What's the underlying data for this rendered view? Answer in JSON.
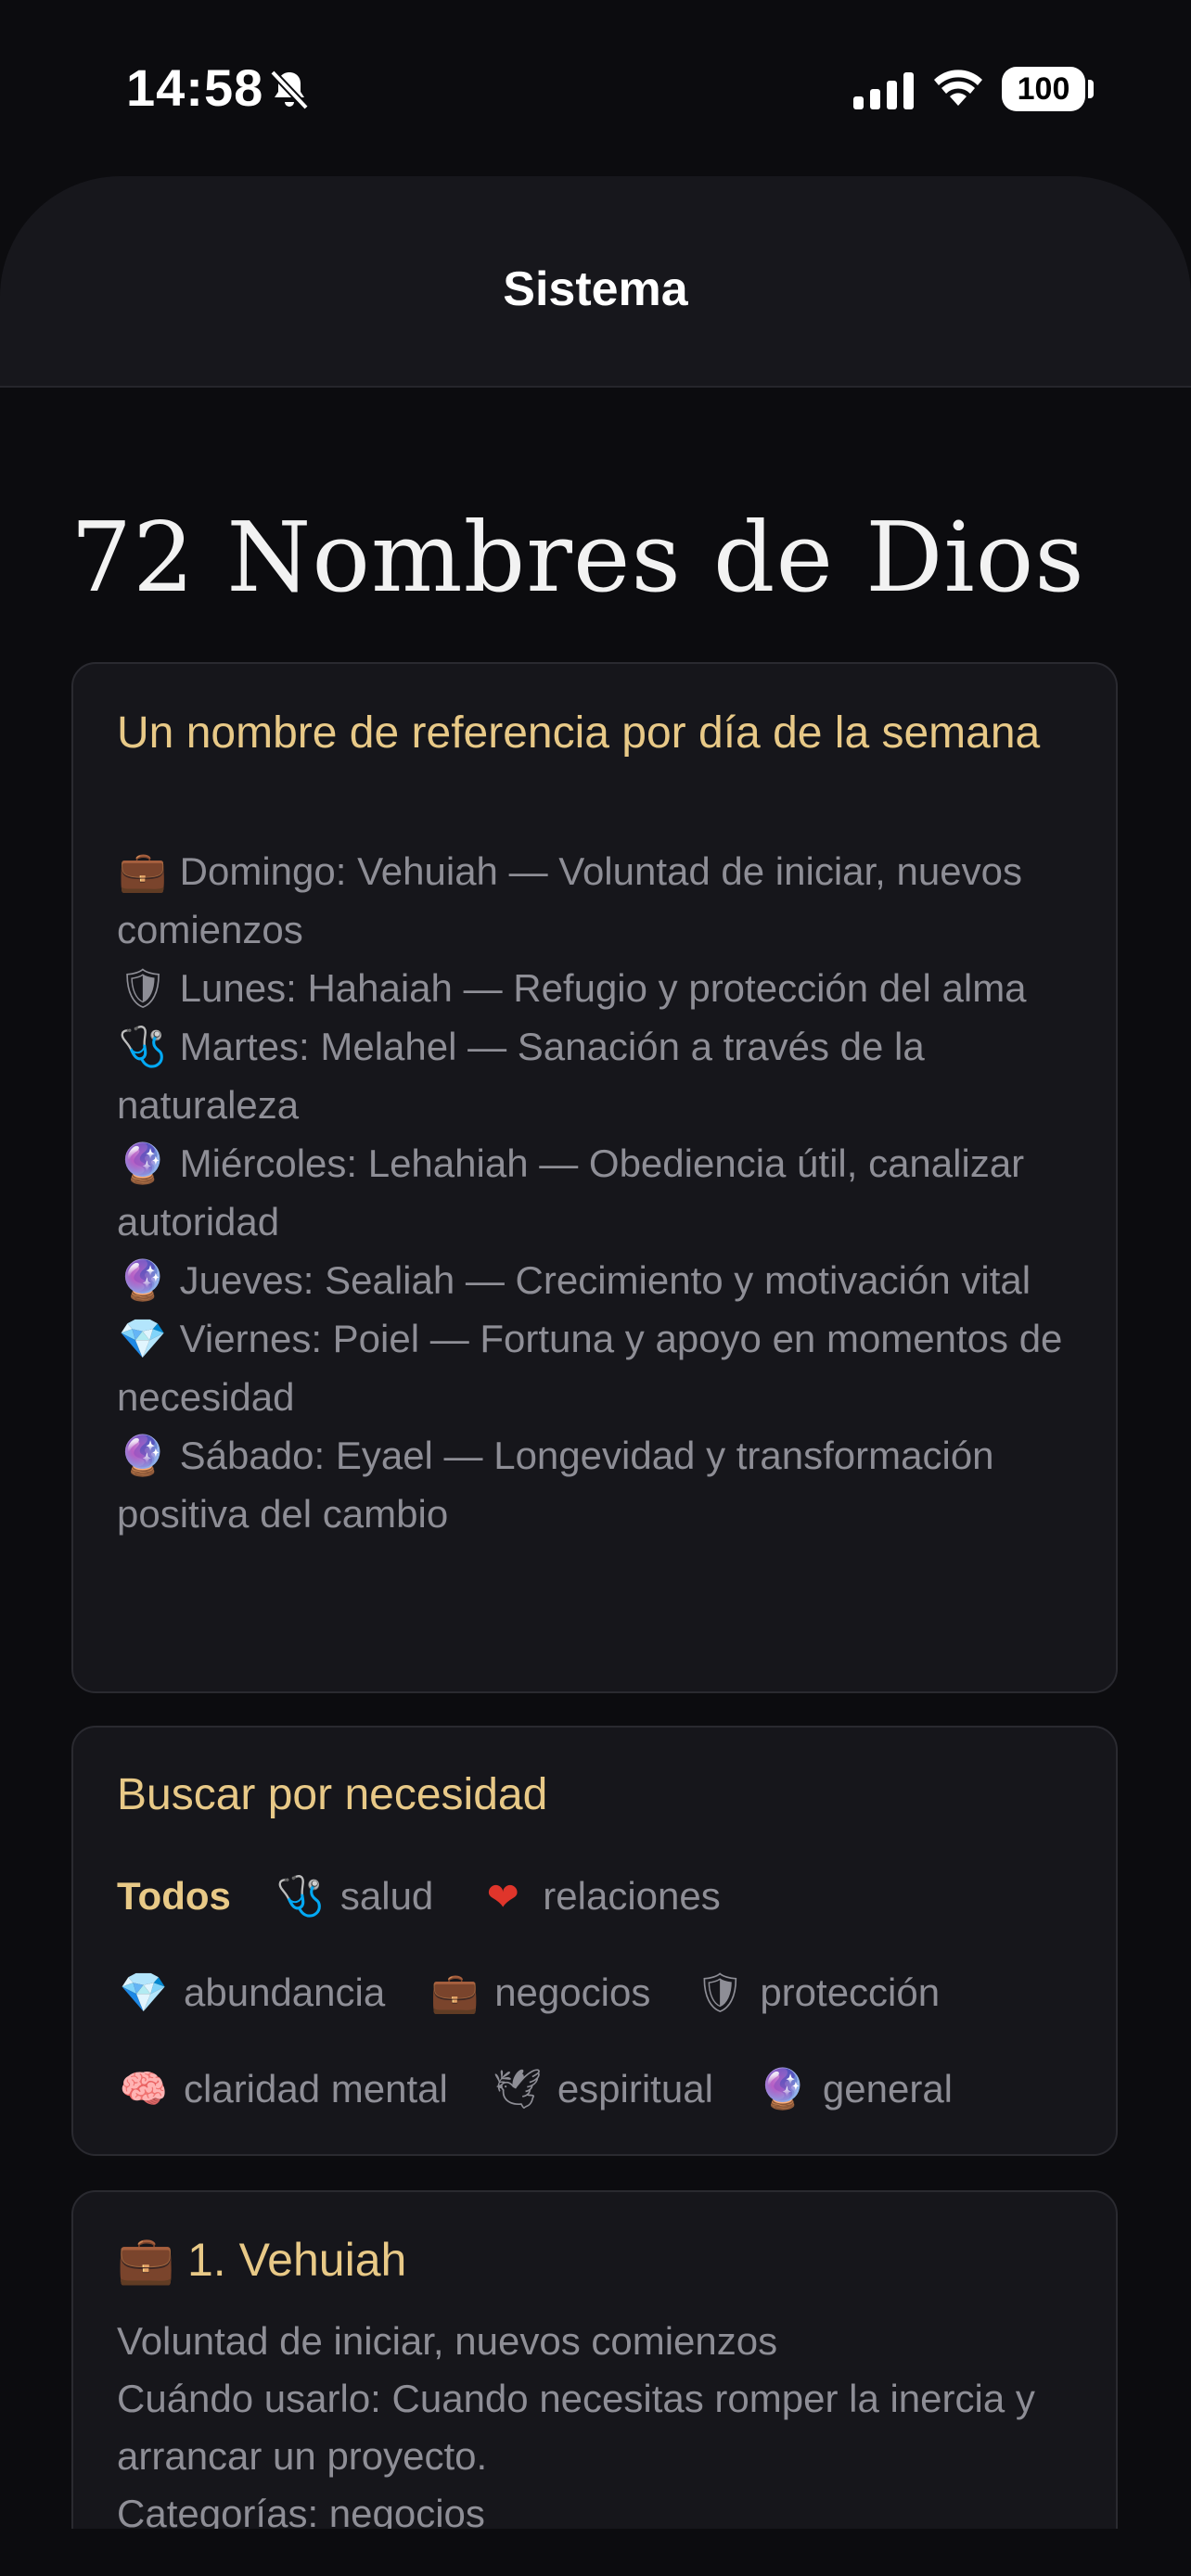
{
  "status_bar": {
    "time": "14:58",
    "battery": "100",
    "icons": [
      "bell-slash-icon",
      "cellular-signal-icon",
      "wifi-icon",
      "battery-icon"
    ]
  },
  "nav": {
    "title": "Sistema"
  },
  "page": {
    "title": "72 Nombres de Dios"
  },
  "week_card": {
    "title": "Un nombre de referencia por día de la semana",
    "days": [
      {
        "icon": "💼",
        "text": "Domingo: Vehuiah — Voluntad de iniciar, nuevos comienzos"
      },
      {
        "icon": "🛡",
        "text": "Lunes: Hahaiah — Refugio y protección del alma"
      },
      {
        "icon": "🩺",
        "text": "Martes: Melahel — Sanación a través de la naturaleza"
      },
      {
        "icon": "🔮",
        "text": "Miércoles: Lehahiah — Obediencia útil, canalizar autoridad"
      },
      {
        "icon": "🔮",
        "text": "Jueves: Sealiah — Crecimiento y motivación vital"
      },
      {
        "icon": "💎",
        "text": "Viernes: Poiel — Fortuna y apoyo en momentos de necesidad"
      },
      {
        "icon": "🔮",
        "text": "Sábado: Eyael — Longevidad y transformación positiva del cambio"
      }
    ]
  },
  "search_card": {
    "title": "Buscar por necesidad",
    "chips": [
      {
        "icon": "",
        "label": "Todos",
        "active": true
      },
      {
        "icon": "🩺",
        "label": "salud"
      },
      {
        "icon": "❤",
        "label": "relaciones"
      },
      {
        "icon": "💎",
        "label": "abundancia"
      },
      {
        "icon": "💼",
        "label": "negocios"
      },
      {
        "icon": "🛡",
        "label": "protección"
      },
      {
        "icon": "🧠",
        "label": "claridad mental"
      },
      {
        "icon": "🕊",
        "label": "espiritual"
      },
      {
        "icon": "🔮",
        "label": "general"
      }
    ]
  },
  "entry_card": {
    "icon": "💼",
    "title": "1. Vehuiah",
    "description": "Voluntad de iniciar, nuevos comienzos",
    "usage": "Cuándo usarlo: Cuando necesitas romper la inercia y arrancar un proyecto.",
    "categories": "Categorías: negocios"
  },
  "colors": {
    "background": "#0c0c0f",
    "card": "#16161b",
    "accent_gold": "#e8c987",
    "body_text": "#8e8e96"
  }
}
